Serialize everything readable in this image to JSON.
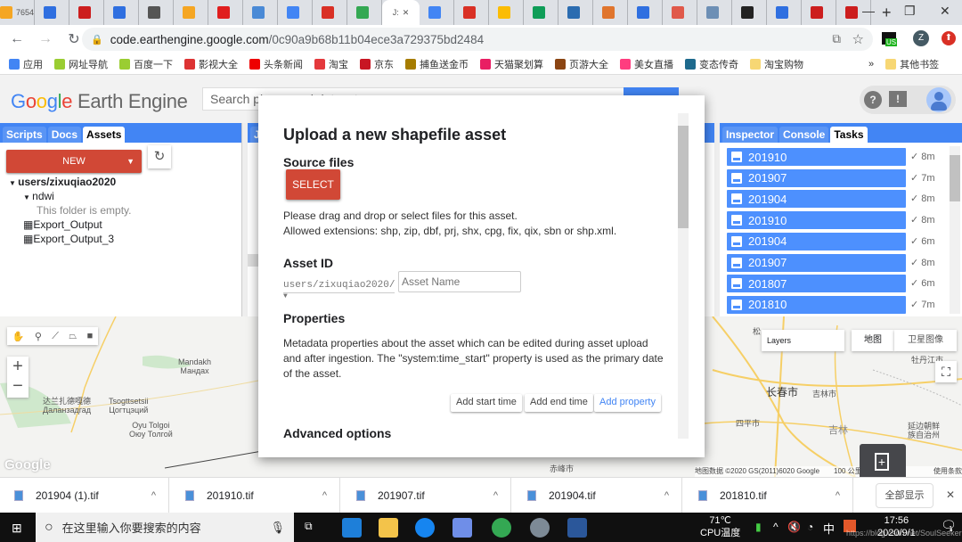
{
  "browser": {
    "tabs": [
      {
        "label": "7654",
        "color": "#f5a623"
      },
      {
        "label": "",
        "color": "#2f6fe0"
      },
      {
        "label": "",
        "color": "#cc1e1e"
      },
      {
        "label": "",
        "color": "#2f6fe0"
      },
      {
        "label": "",
        "color": "#555555"
      },
      {
        "label": "",
        "color": "#f5a623"
      },
      {
        "label": "",
        "color": "#e01e1e"
      },
      {
        "label": "",
        "color": "#4a8ad6"
      },
      {
        "label": "",
        "color": "#4285f4"
      },
      {
        "label": "",
        "color": "#d93025"
      },
      {
        "label": "",
        "color": "#34a853"
      },
      {
        "label": "J:",
        "color": "#ffffff",
        "active": true
      },
      {
        "label": "",
        "color": "#4285f4"
      },
      {
        "label": "",
        "color": "#d93025"
      },
      {
        "label": "",
        "color": "#fbbc05"
      },
      {
        "label": "",
        "color": "#0f9d58"
      },
      {
        "label": "",
        "color": "#2b6cb0"
      },
      {
        "label": "",
        "color": "#e0752d"
      },
      {
        "label": "",
        "color": "#2f6fe0"
      },
      {
        "label": "",
        "color": "#e0594a"
      },
      {
        "label": "",
        "color": "#6d8fb5"
      },
      {
        "label": "",
        "color": "#222222"
      },
      {
        "label": "",
        "color": "#2f6fe0"
      },
      {
        "label": "",
        "color": "#cc1e1e"
      },
      {
        "label": "",
        "color": "#cc1e1e"
      }
    ],
    "url_host": "code.earthengine.google.com",
    "url_path": "/0c90a9b68b11b04ece3a729375bd2484",
    "profile_initial": "Z",
    "extension_badge": "US",
    "bookmarks": [
      {
        "label": "应用",
        "color": "#4285f4"
      },
      {
        "label": "网址导航",
        "color": "#9acd32"
      },
      {
        "label": "百度一下",
        "color": "#9acd32"
      },
      {
        "label": "影视大全",
        "color": "#d33"
      },
      {
        "label": "头条新闻",
        "color": "#e00"
      },
      {
        "label": "淘宝",
        "color": "#e4393c"
      },
      {
        "label": "京东",
        "color": "#c81623"
      },
      {
        "label": "捕鱼送金币",
        "color": "#a67c00"
      },
      {
        "label": "天猫聚划算",
        "color": "#e91e63"
      },
      {
        "label": "页游大全",
        "color": "#8b4513"
      },
      {
        "label": "美女直播",
        "color": "#ff3d7f"
      },
      {
        "label": "变态传奇",
        "color": "#1e6a8d"
      },
      {
        "label": "淘宝购物",
        "color": "#f7d774"
      }
    ],
    "bookmarks_overflow": "»",
    "other_bookmarks": "其他书签"
  },
  "ee": {
    "logo_google": "Google",
    "logo_product": "Earth Engine",
    "search_placeholder": "Search places and datasets",
    "left_tabs": [
      "Scripts",
      "Docs",
      "Assets"
    ],
    "left_active": "Assets",
    "new_label": "NEW",
    "tree": {
      "root": "users/zixuqiao2020",
      "folder": "ndwi",
      "empty": "This folder is empty.",
      "tables": [
        "Export_Output",
        "Export_Output_3"
      ]
    },
    "editor_tab": "J:",
    "right_tabs": [
      "Inspector",
      "Console",
      "Tasks"
    ],
    "right_active": "Tasks",
    "tasks": [
      {
        "name": "201910",
        "time": "8m"
      },
      {
        "name": "201907",
        "time": "7m"
      },
      {
        "name": "201904",
        "time": "8m"
      },
      {
        "name": "201910",
        "time": "8m"
      },
      {
        "name": "201904",
        "time": "6m"
      },
      {
        "name": "201907",
        "time": "8m"
      },
      {
        "name": "201807",
        "time": "6m"
      },
      {
        "name": "201810",
        "time": "7m"
      }
    ]
  },
  "map": {
    "labels": [
      "Mandakh\nМандах",
      "达兰扎德嘎德\nДаланзадгад",
      "Tsogttsetsii\nЦогтцэций",
      "Oyu Tolgoi\nОюу Толгой",
      "长春市",
      "吉林市",
      "四平市",
      "吉林",
      "牡丹江市",
      "延边朝鲜\n族自治州",
      "赤峰市",
      "松"
    ],
    "layers_label": "Layers",
    "map_type_map": "地图",
    "map_type_satellite": "卫星图像",
    "attribution": "地图数据 ©2020 GS(2011)6020 Google",
    "scale": "100 公里",
    "terms": "使用条款",
    "google_watermark": "Google"
  },
  "dialog": {
    "title": "Upload a new shapefile asset",
    "source_heading": "Source files",
    "select_label": "SELECT",
    "source_help1": "Please drag and drop or select files for this asset.",
    "source_help2": "Allowed extensions: shp, zip, dbf, prj, shx, cpg, fix, qix, sbn or shp.xml.",
    "asset_id_heading": "Asset ID",
    "asset_prefix": "users/zixuqiao2020/",
    "asset_name_placeholder": "Asset Name",
    "properties_heading": "Properties",
    "properties_help": "Metadata properties about the asset which can be edited during asset upload and after ingestion. The \"system:time_start\" property is used as the primary date of the asset.",
    "add_start": "Add start time",
    "add_end": "Add end time",
    "add_property": "Add property",
    "advanced_heading": "Advanced options"
  },
  "downloads": {
    "files": [
      "201904 (1).tif",
      "201910.tif",
      "201907.tif",
      "201904.tif",
      "201810.tif"
    ],
    "show_all": "全部显示"
  },
  "taskbar": {
    "search_placeholder": "在这里输入你要搜索的内容",
    "temp": "71℃",
    "temp_label": "CPU温度",
    "ime": "中",
    "time": "17:56",
    "date": "2020/9/1",
    "watermark": "https://blog.csdn.net/SoulSeeker",
    "notif_count": "1"
  }
}
